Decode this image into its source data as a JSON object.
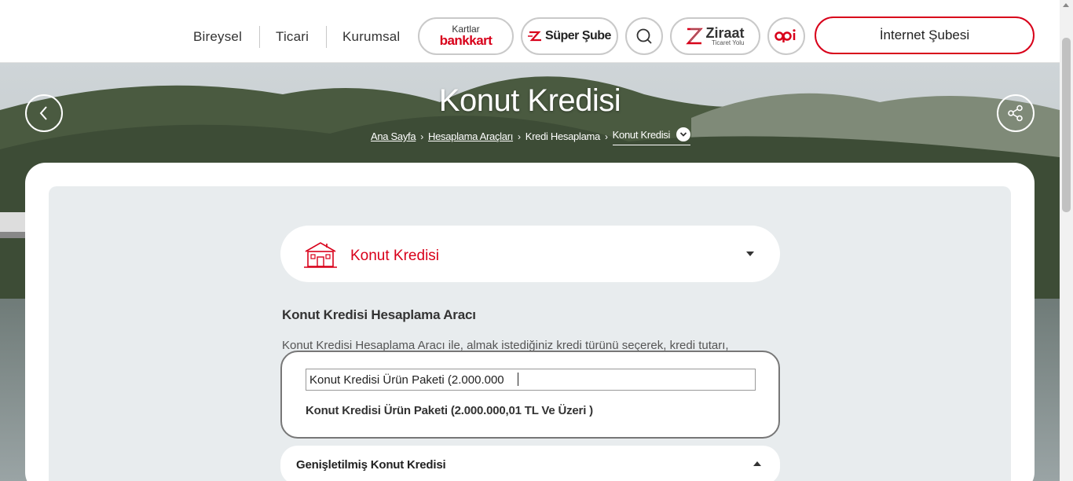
{
  "header": {
    "nav": [
      "Bireysel",
      "Ticari",
      "Kurumsal"
    ],
    "bankkart_top": "Kartlar",
    "bankkart_bottom": "bankkart",
    "super_sube": "Süper Şube",
    "ziraat_main": "Ziraat",
    "ziraat_sub": "Ticaret Yolu",
    "internet_subesi": "İnternet Şubesi"
  },
  "hero": {
    "title": "Konut Kredisi",
    "breadcrumb": [
      "Ana Sayfa",
      "Hesaplama Araçları",
      "Kredi Hesaplama",
      "Konut Kredisi"
    ]
  },
  "calculator": {
    "product": "Konut Kredisi",
    "section_title": "Konut Kredisi Hesaplama Aracı",
    "description": "Konut Kredisi Hesaplama Aracı ile, almak istediğiniz kredi türünü seçerek, kredi tutarı,",
    "search_value": "Konut Kredisi Ürün Paketi (2.000.000",
    "option": "Konut Kredisi Ürün Paketi (2.000.000,01 TL Ve Üzeri )",
    "accordion_label": "Genişletilmiş Konut Kredisi"
  },
  "colors": {
    "brand": "#d8001a"
  }
}
